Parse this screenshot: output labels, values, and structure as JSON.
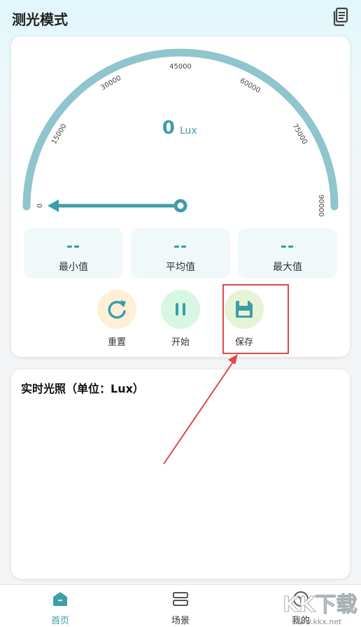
{
  "header": {
    "title": "测光模式",
    "history_icon": "document-history-icon"
  },
  "gauge": {
    "value": "0",
    "unit": "Lux",
    "min": 0,
    "max": 90000,
    "ticks": [
      "0",
      "15000",
      "30000",
      "45000",
      "60000",
      "75000",
      "90000"
    ],
    "accent_color": "#8fc5cc",
    "needle_color": "#3d9ea8"
  },
  "stats": [
    {
      "value": "--",
      "label": "最小值"
    },
    {
      "value": "--",
      "label": "平均值"
    },
    {
      "value": "--",
      "label": "最大值"
    }
  ],
  "controls": {
    "reset": {
      "label": "重置",
      "icon": "refresh-icon",
      "bg": "#fdf0d6"
    },
    "start": {
      "label": "开始",
      "icon": "pause-icon",
      "bg": "#d8f6e4"
    },
    "save": {
      "label": "保存",
      "icon": "floppy-disk-icon",
      "bg": "#e7f3d5"
    }
  },
  "chart": {
    "title": "实时光照（单位：Lux）"
  },
  "nav": [
    {
      "label": "首页",
      "icon": "home-icon",
      "active": true
    },
    {
      "label": "场景",
      "icon": "scene-icon",
      "active": false
    },
    {
      "label": "我的",
      "icon": "profile-icon",
      "active": false
    }
  ],
  "watermark": {
    "text": "KK下载",
    "url_text": "www.kkx.net"
  }
}
